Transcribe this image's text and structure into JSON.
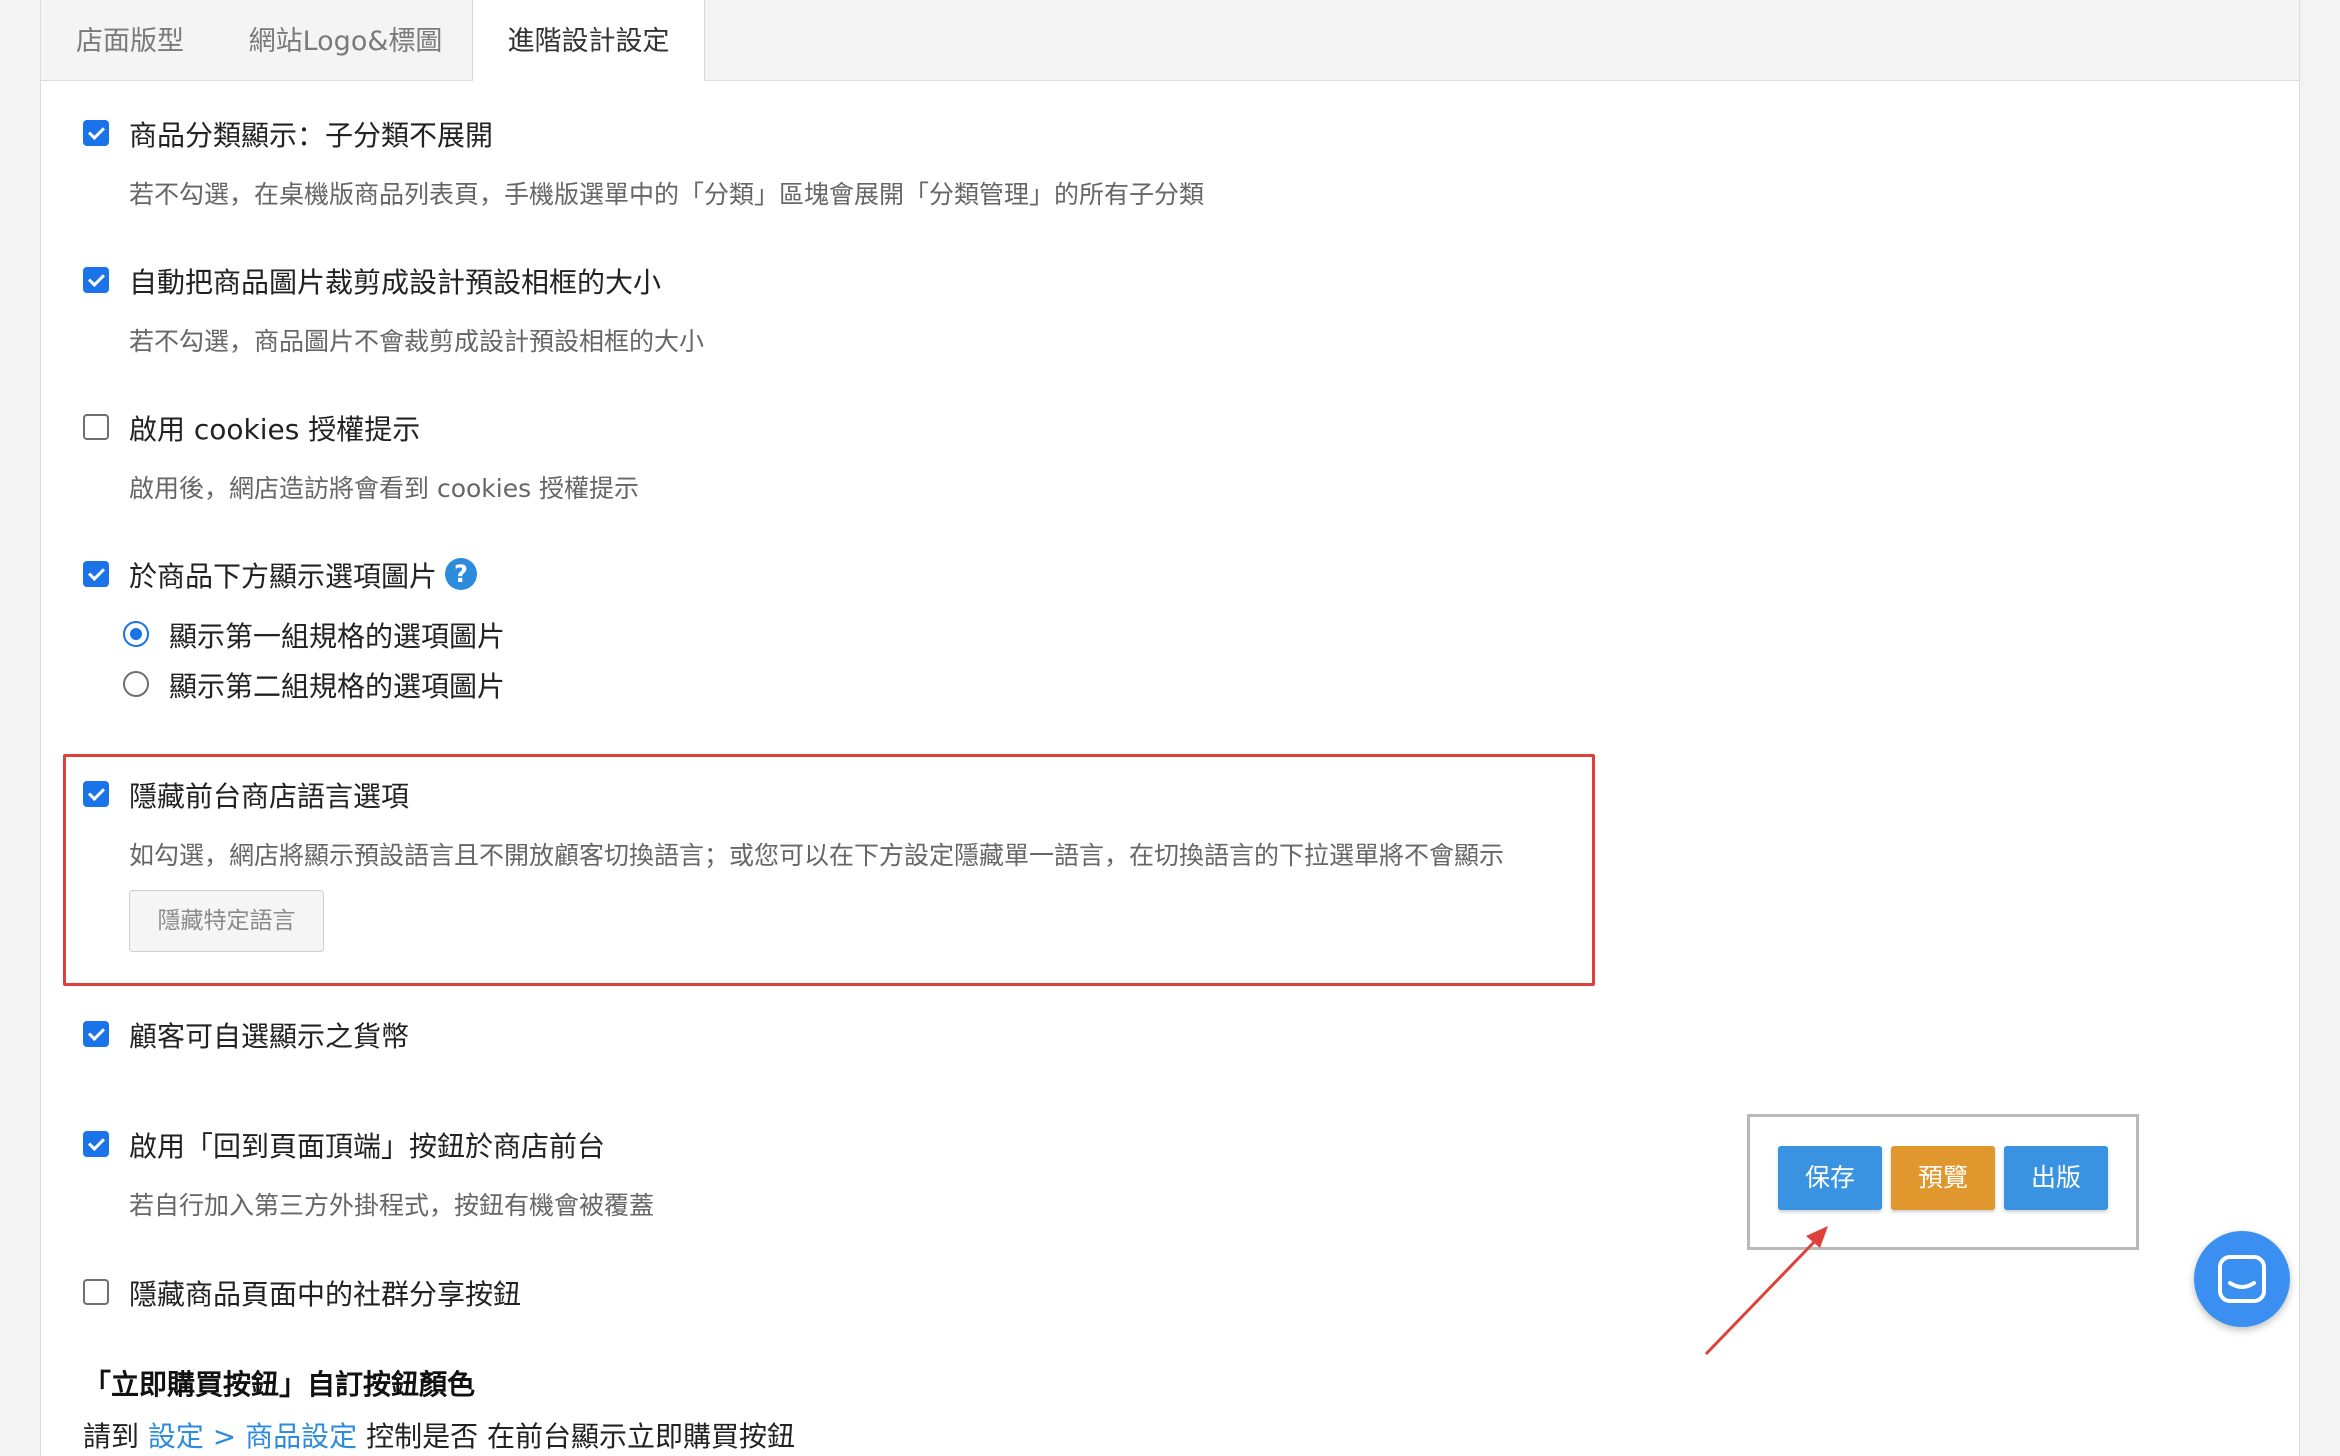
{
  "tabs": [
    {
      "label": "店面版型"
    },
    {
      "label": "網站Logo&標圖"
    },
    {
      "label": "進階設計設定"
    }
  ],
  "options": {
    "category_display": {
      "label": "商品分類顯示：子分類不展開",
      "checked": true,
      "desc": "若不勾選，在桌機版商品列表頁，手機版選單中的「分類」區塊會展開「分類管理」的所有子分類"
    },
    "auto_crop": {
      "label": "自動把商品圖片裁剪成設計預設相框的大小",
      "checked": true,
      "desc": "若不勾選，商品圖片不會裁剪成設計預設相框的大小"
    },
    "cookies": {
      "label": "啟用 cookies 授權提示",
      "checked": false,
      "desc": "啟用後，網店造訪將會看到 cookies 授權提示"
    },
    "option_images": {
      "label": "於商品下方顯示選項圖片",
      "checked": true,
      "radio1": "顯示第一組規格的選項圖片",
      "radio2": "顯示第二組規格的選項圖片",
      "selected": 1
    },
    "hide_language": {
      "label": "隱藏前台商店語言選項",
      "checked": true,
      "desc": "如勾選，網店將顯示預設語言且不開放顧客切換語言；或您可以在下方設定隱藏單一語言，在切換語言的下拉選單將不會顯示",
      "button": "隱藏特定語言"
    },
    "currency": {
      "label": "顧客可自選顯示之貨幣",
      "checked": true
    },
    "back_to_top": {
      "label": "啟用「回到頁面頂端」按鈕於商店前台",
      "checked": true,
      "desc": "若自行加入第三方外掛程式，按鈕有機會被覆蓋"
    },
    "hide_social": {
      "label": "隱藏商品頁面中的社群分享按鈕",
      "checked": false
    }
  },
  "buy_now": {
    "title": "「立即購買按鈕」自訂按鈕顏色",
    "prefix": "請到 ",
    "link": "設定 > 商品設定",
    "suffix": " 控制是否 在前台顯示立即購買按鈕"
  },
  "actions": {
    "save": "保存",
    "preview": "預覽",
    "publish": "出版"
  },
  "icons": {
    "help": "?"
  },
  "colors": {
    "accent": "#1a73e8",
    "save": "#3a93e0",
    "preview": "#e0982e",
    "publish": "#3a93e0",
    "highlight": "#e0403a"
  }
}
